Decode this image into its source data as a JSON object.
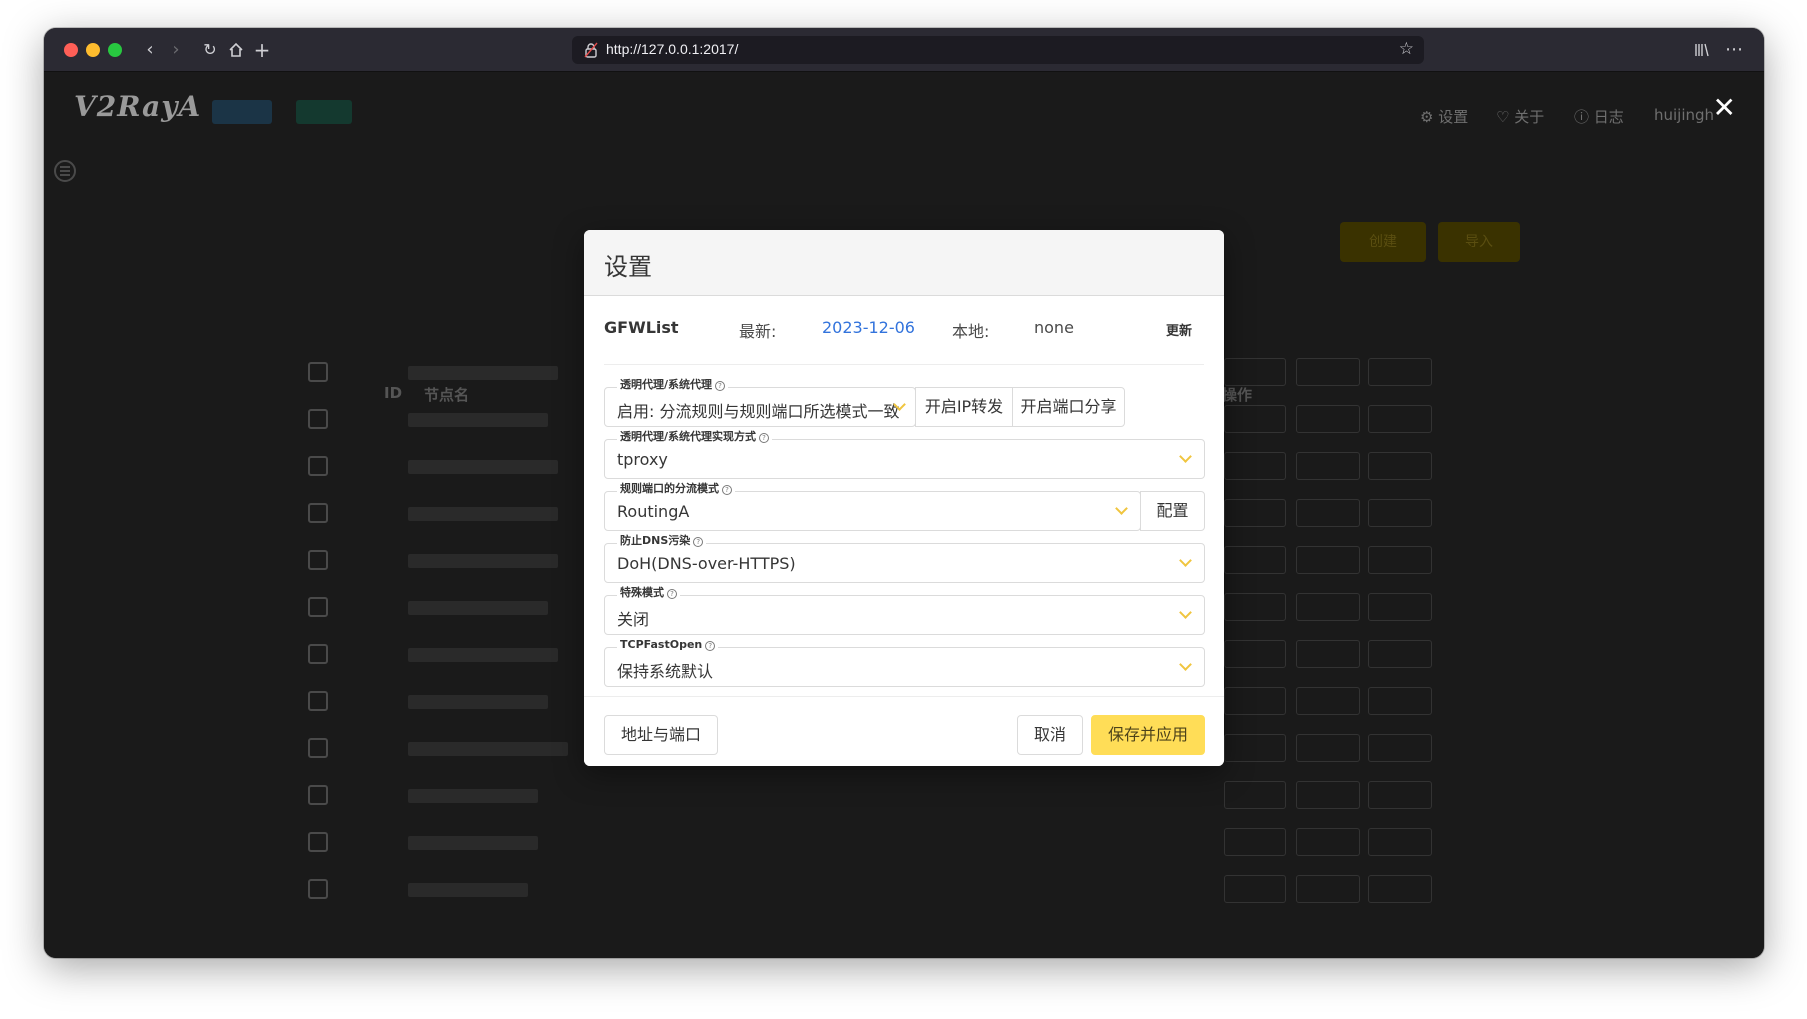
{
  "browser": {
    "url": "http://127.0.0.1:2017/",
    "icons": [
      "back-icon",
      "forward-icon",
      "reload-icon",
      "home-icon",
      "new-tab-icon",
      "lock-icon",
      "bookmark-star-icon",
      "library-icon",
      "more-icon"
    ]
  },
  "app": {
    "logo": "V2RayA",
    "nav": {
      "settings": "设置",
      "about": "关于",
      "log": "日志",
      "user": "huijingh"
    },
    "create_label": "创建",
    "import_label": "导入",
    "table_headers": {
      "id": "ID",
      "name": "节点名",
      "actions": "操作"
    }
  },
  "modal": {
    "title": "设置",
    "gfwlist": {
      "label": "GFWList",
      "latest_label": "最新:",
      "latest_value": "2023-12-06",
      "local_label": "本地:",
      "local_value": "none",
      "update_label": "更新"
    },
    "fields": {
      "transparent_proxy": {
        "label": "透明代理/系统代理",
        "value": "启用: 分流规则与规则端口所选模式一致",
        "addon1": "开启IP转发",
        "addon2": "开启端口分享"
      },
      "proxy_method": {
        "label": "透明代理/系统代理实现方式",
        "value": "tproxy"
      },
      "routing_mode": {
        "label": "规则端口的分流模式",
        "value": "RoutingA",
        "addon": "配置"
      },
      "dns": {
        "label": "防止DNS污染",
        "value": "DoH(DNS-over-HTTPS)"
      },
      "special_mode": {
        "label": "特殊模式",
        "value": "关闭"
      },
      "tcp_fast_open": {
        "label": "TCPFastOpen",
        "value": "保持系统默认"
      }
    },
    "footer": {
      "address_port": "地址与端口",
      "cancel": "取消",
      "save_apply": "保存并应用"
    }
  },
  "colors": {
    "primary": "#ffdd57",
    "link": "#3273dc",
    "chevron": "#f0c53f",
    "overlay_bg": "#1a1a1a"
  }
}
